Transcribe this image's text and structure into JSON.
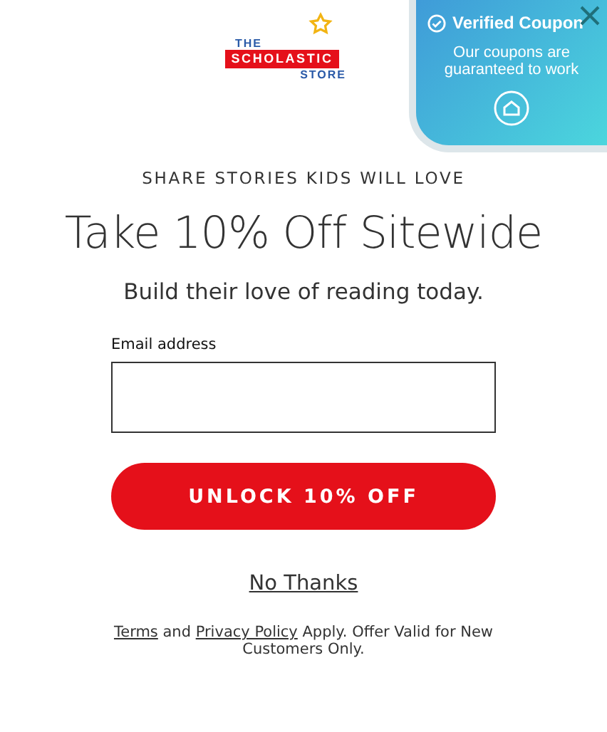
{
  "logo": {
    "top": "THE",
    "middle": "SCHOLASTIC",
    "bottom": "STORE"
  },
  "coupon": {
    "title": "Verified Coupon",
    "text": "Our coupons are guaranteed to work"
  },
  "eyebrow": "SHARE STORIES KIDS WILL LOVE",
  "headline": "Take 10% Off Sitewide",
  "subtitle": "Build their love of reading today.",
  "email": {
    "label": "Email address"
  },
  "submit_button": "UNLOCK 10% OFF",
  "decline_link": "No Thanks",
  "footer": {
    "terms_link": "Terms",
    "joiner": "and",
    "privacy_link": "Privacy Policy",
    "rest": "Apply. Offer Valid for New Customers Only."
  }
}
